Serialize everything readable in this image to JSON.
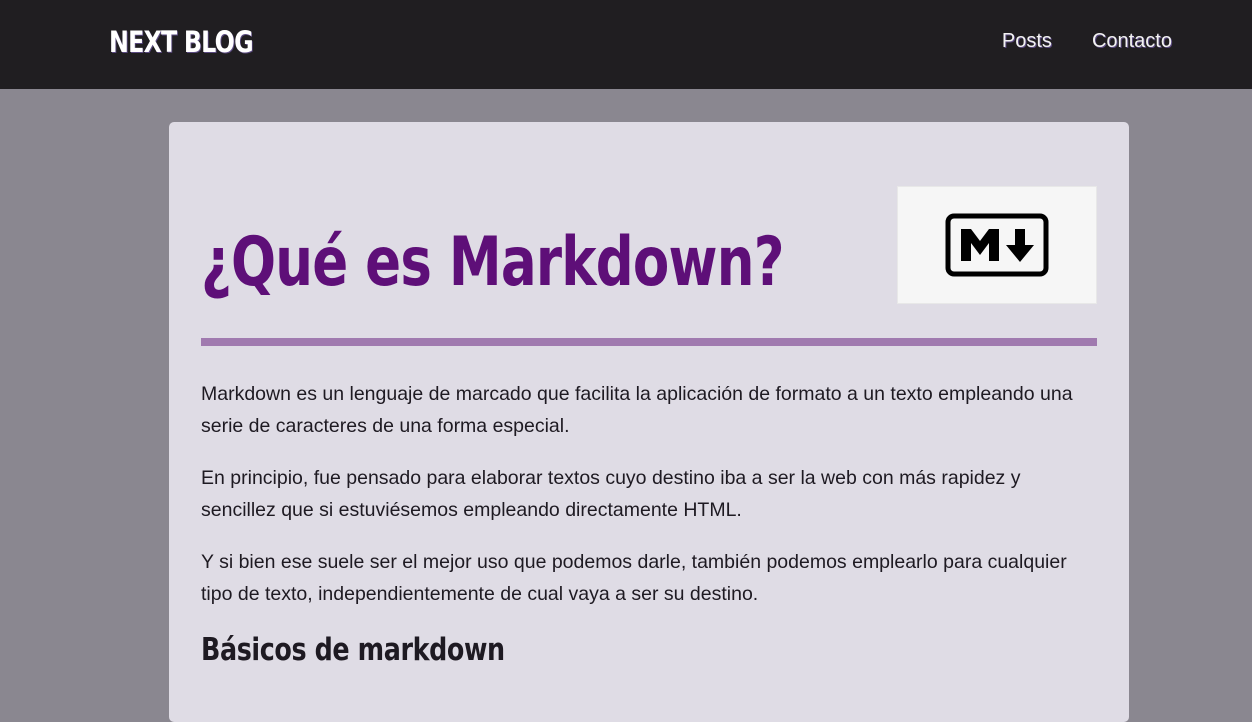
{
  "navbar": {
    "brand": "NEXT BLOG",
    "links": [
      {
        "label": "Posts"
      },
      {
        "label": "Contacto"
      }
    ]
  },
  "post": {
    "title": "¿Qué es Markdown?",
    "paragraphs": [
      "Markdown es un lenguaje de marcado que facilita la aplicación de formato a un texto empleando una serie de caracteres de una forma especial.",
      "En principio, fue pensado para elaborar textos cuyo destino iba a ser la web con más rapidez y sencillez que si estuviésemos empleando directamente HTML.",
      "Y si bien ese suele ser el mejor uso que podemos darle, también podemos emplearlo para cualquier tipo de texto, independientemente de cual vaya a ser su destino."
    ],
    "section_heading": "Básicos de markdown",
    "image_icon": "markdown-logo-icon"
  },
  "colors": {
    "navbar_bg": "#201e21",
    "page_bg": "#8a8790",
    "card_bg": "#dfdce5",
    "title": "#5e0f78",
    "divider": "#a07aaf"
  }
}
